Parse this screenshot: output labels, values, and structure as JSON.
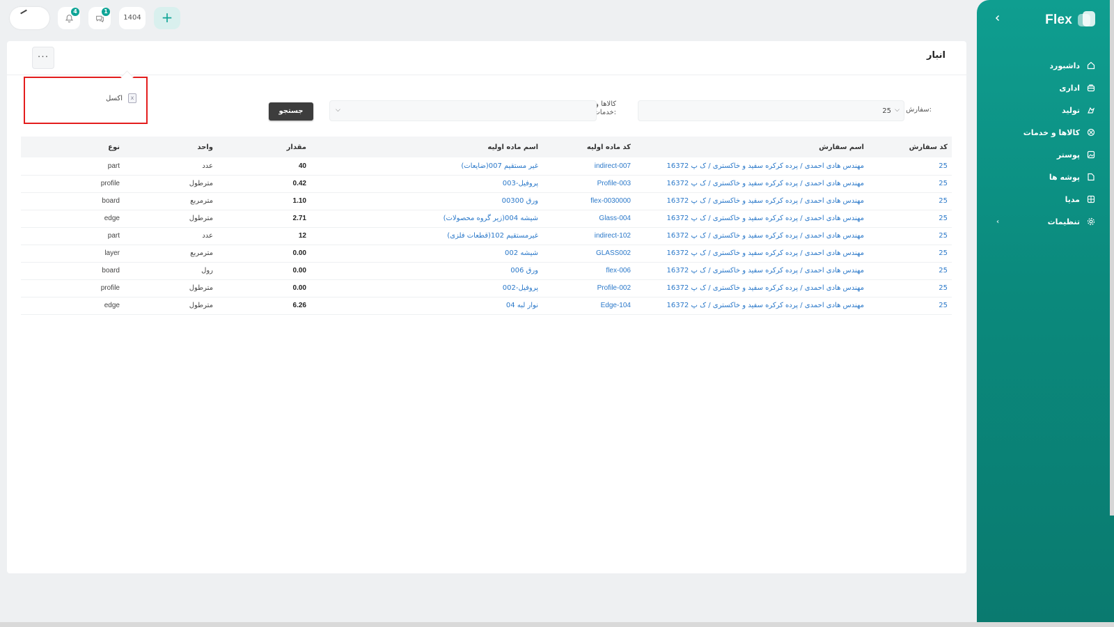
{
  "app": {
    "brand": "Flex"
  },
  "topbar": {
    "notifications_count": "4",
    "messages_count": "1",
    "year": "1404",
    "add_label": "+"
  },
  "sidebar": {
    "items": [
      {
        "label": "داشبورد",
        "icon": "home-icon"
      },
      {
        "label": "اداری",
        "icon": "briefcase-icon"
      },
      {
        "label": "تولید",
        "icon": "factory-icon"
      },
      {
        "label": "کالاها و خدمات",
        "icon": "box-icon"
      },
      {
        "label": "پوستر",
        "icon": "image-icon"
      },
      {
        "label": "پوشه ها",
        "icon": "folder-icon"
      },
      {
        "label": "مدیا",
        "icon": "media-icon"
      },
      {
        "label": "تنظیمات",
        "icon": "gear-icon"
      }
    ]
  },
  "page": {
    "title": "انبار",
    "more_label": "···"
  },
  "dropdown": {
    "excel_label": "اکسل"
  },
  "filters": {
    "order_label": "سفارش:",
    "order_value": "25",
    "goods_label_1": "کالاها و",
    "goods_label_2": "خدمات:",
    "search_label": "جستجو"
  },
  "table": {
    "headers": [
      "کد سفارش",
      "اسم سفارش",
      "کد ماده اولیه",
      "اسم ماده اولیه",
      "مقدار",
      "واحد",
      "نوع"
    ],
    "rows": [
      [
        "25",
        "مهندس هادی احمدی / پرده کرکره سفید و خاکستری / ک پ 16372",
        "indirect-007",
        "غیر مستقیم 007(ضایعات)",
        "40",
        "عدد",
        "part"
      ],
      [
        "25",
        "مهندس هادی احمدی / پرده کرکره سفید و خاکستری / ک پ 16372",
        "Profile-003",
        "پروفیل-003",
        "0.42",
        "مترطول",
        "profile"
      ],
      [
        "25",
        "مهندس هادی احمدی / پرده کرکره سفید و خاکستری / ک پ 16372",
        "flex-0030000",
        "ورق 00300",
        "1.10",
        "مترمربع",
        "board"
      ],
      [
        "25",
        "مهندس هادی احمدی / پرده کرکره سفید و خاکستری / ک پ 16372",
        "Glass-004",
        "شیشه 004(زیر گروه محصولات)",
        "2.71",
        "مترطول",
        "edge"
      ],
      [
        "25",
        "مهندس هادی احمدی / پرده کرکره سفید و خاکستری / ک پ 16372",
        "indirect-102",
        "غیرمستقیم 102(قطعات فلزی)",
        "12",
        "عدد",
        "part"
      ],
      [
        "25",
        "مهندس هادی احمدی / پرده کرکره سفید و خاکستری / ک پ 16372",
        "GLASS002",
        "شیشه 002",
        "0.00",
        "مترمربع",
        "layer"
      ],
      [
        "25",
        "مهندس هادی احمدی / پرده کرکره سفید و خاکستری / ک پ 16372",
        "flex-006",
        "ورق 006",
        "0.00",
        "رول",
        "board"
      ],
      [
        "25",
        "مهندس هادی احمدی / پرده کرکره سفید و خاکستری / ک پ 16372",
        "Profile-002",
        "پروفیل-002",
        "0.00",
        "مترطول",
        "profile"
      ],
      [
        "25",
        "مهندس هادی احمدی / پرده کرکره سفید و خاکستری / ک پ 16372",
        "Edge-104",
        "نوار لبه 04",
        "6.26",
        "مترطول",
        "edge"
      ]
    ]
  },
  "colors": {
    "accent": "#10a597",
    "link": "#2a78c9",
    "highlight": "#e31d1d"
  }
}
